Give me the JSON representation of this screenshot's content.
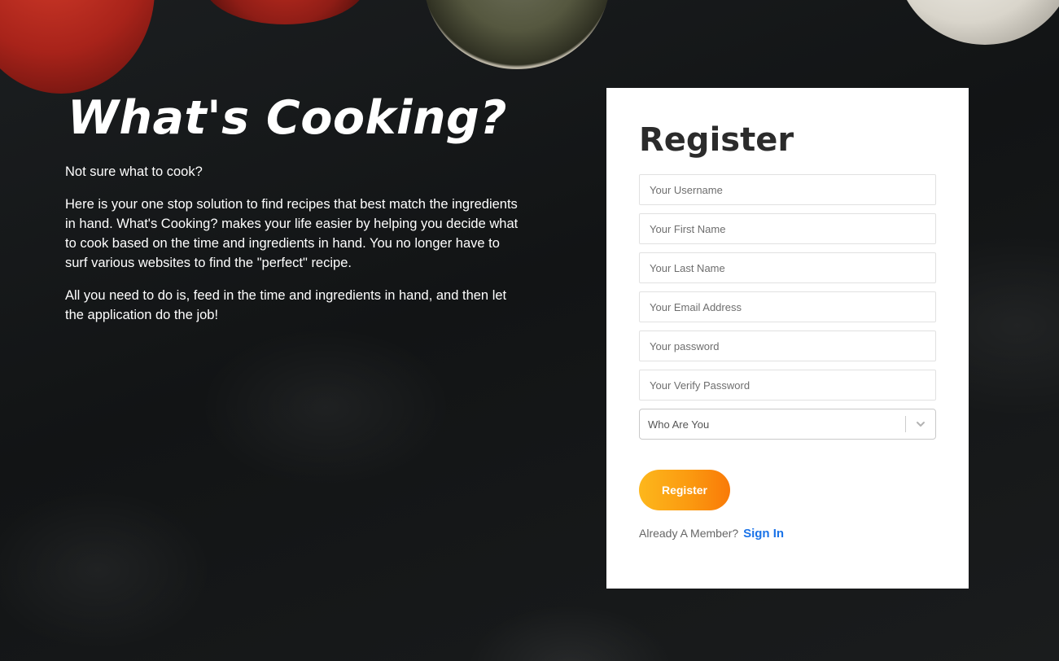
{
  "hero": {
    "title": "What's Cooking?",
    "intro": "Not sure what to cook?",
    "paragraph1": "Here is your one stop solution to find recipes that best match the ingredients in hand. What's Cooking? makes your life easier by helping you decide what to cook based on the time and ingredients in hand. You no longer have to surf various websites to find the \"perfect\" recipe.",
    "paragraph2": "All you need to do is, feed in the time and ingredients in hand, and then let the application do the job!"
  },
  "register": {
    "title": "Register",
    "fields": {
      "username": {
        "placeholder": "Your Username",
        "value": ""
      },
      "first_name": {
        "placeholder": "Your First Name",
        "value": ""
      },
      "last_name": {
        "placeholder": "Your Last Name",
        "value": ""
      },
      "email": {
        "placeholder": "Your Email Address",
        "value": ""
      },
      "password": {
        "placeholder": "Your password",
        "value": ""
      },
      "verify_password": {
        "placeholder": "Your Verify Password",
        "value": ""
      }
    },
    "role_select": {
      "placeholder": "Who Are You",
      "icon": "chevron-down-icon"
    },
    "submit_label": "Register",
    "already_member_text": "Already A Member?",
    "signin_label": "Sign In"
  },
  "colors": {
    "button_gradient_start": "#fdb71c",
    "button_gradient_end": "#f97a08",
    "link": "#1a73e8",
    "card_bg": "#ffffff",
    "page_bg": "#141617"
  }
}
